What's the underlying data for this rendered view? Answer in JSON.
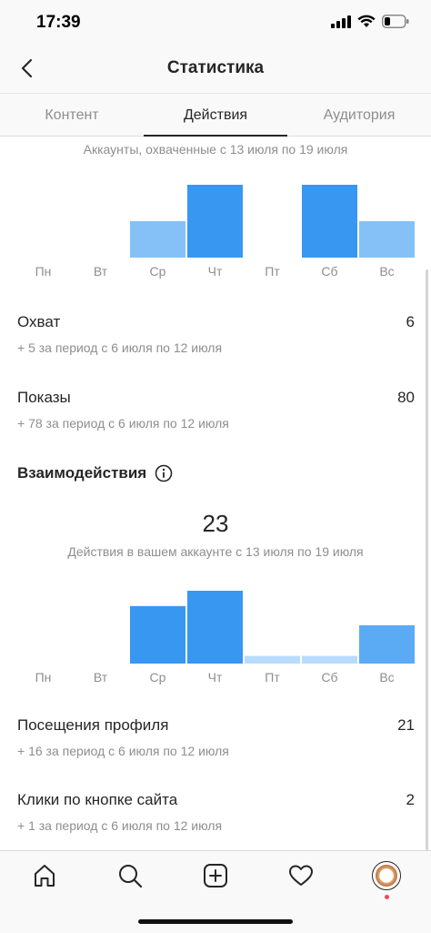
{
  "status_bar": {
    "time": "17:39"
  },
  "header": {
    "title": "Статистика"
  },
  "tabs": [
    {
      "label": "Контент"
    },
    {
      "label": "Действия"
    },
    {
      "label": "Аудитория"
    }
  ],
  "reach_section": {
    "caption": "Аккаунты, охваченные с 13 июля по 19 июля",
    "chart_data": {
      "type": "bar",
      "categories": [
        "Пн",
        "Вт",
        "Ср",
        "Чт",
        "Пт",
        "Сб",
        "Вс"
      ],
      "values": [
        0,
        0,
        1,
        2,
        0,
        2,
        1
      ],
      "ylim": [
        0,
        2
      ],
      "colors": [
        "#3897f0",
        "#3897f0",
        "#85c1f7",
        "#3897f0",
        "#3897f0",
        "#3897f0",
        "#85c1f7"
      ]
    },
    "metrics": [
      {
        "label": "Охват",
        "value": "6",
        "change": "+ 5 за период с 6 июля по 12 июля"
      },
      {
        "label": "Показы",
        "value": "80",
        "change": "+ 78 за период с 6 июля по 12 июля"
      }
    ]
  },
  "interactions_section": {
    "title": "Взаимодействия",
    "total": "23",
    "caption": "Действия в вашем аккаунте с 13 июля по 19 июля",
    "chart_data": {
      "type": "bar",
      "categories": [
        "Пн",
        "Вт",
        "Ср",
        "Чт",
        "Пт",
        "Сб",
        "Вс"
      ],
      "values": [
        0,
        0,
        7.5,
        9.5,
        1,
        1,
        5
      ],
      "ylim": [
        0,
        9.5
      ],
      "colors": [
        "#3897f0",
        "#3897f0",
        "#3897f0",
        "#3897f0",
        "#b8dcfb",
        "#b8dcfb",
        "#5aabf4"
      ]
    },
    "metrics": [
      {
        "label": "Посещения профиля",
        "value": "21",
        "change": "+ 16 за период с 6 июля по 12 июля"
      },
      {
        "label": "Клики по кнопке сайта",
        "value": "2",
        "change": "+ 1 за период с 6 июля по 12 июля"
      }
    ]
  },
  "bottom_nav": {
    "items": [
      {
        "icon": "home-icon"
      },
      {
        "icon": "search-icon"
      },
      {
        "icon": "add-post-icon"
      },
      {
        "icon": "heart-icon"
      },
      {
        "icon": "profile-avatar"
      }
    ]
  }
}
